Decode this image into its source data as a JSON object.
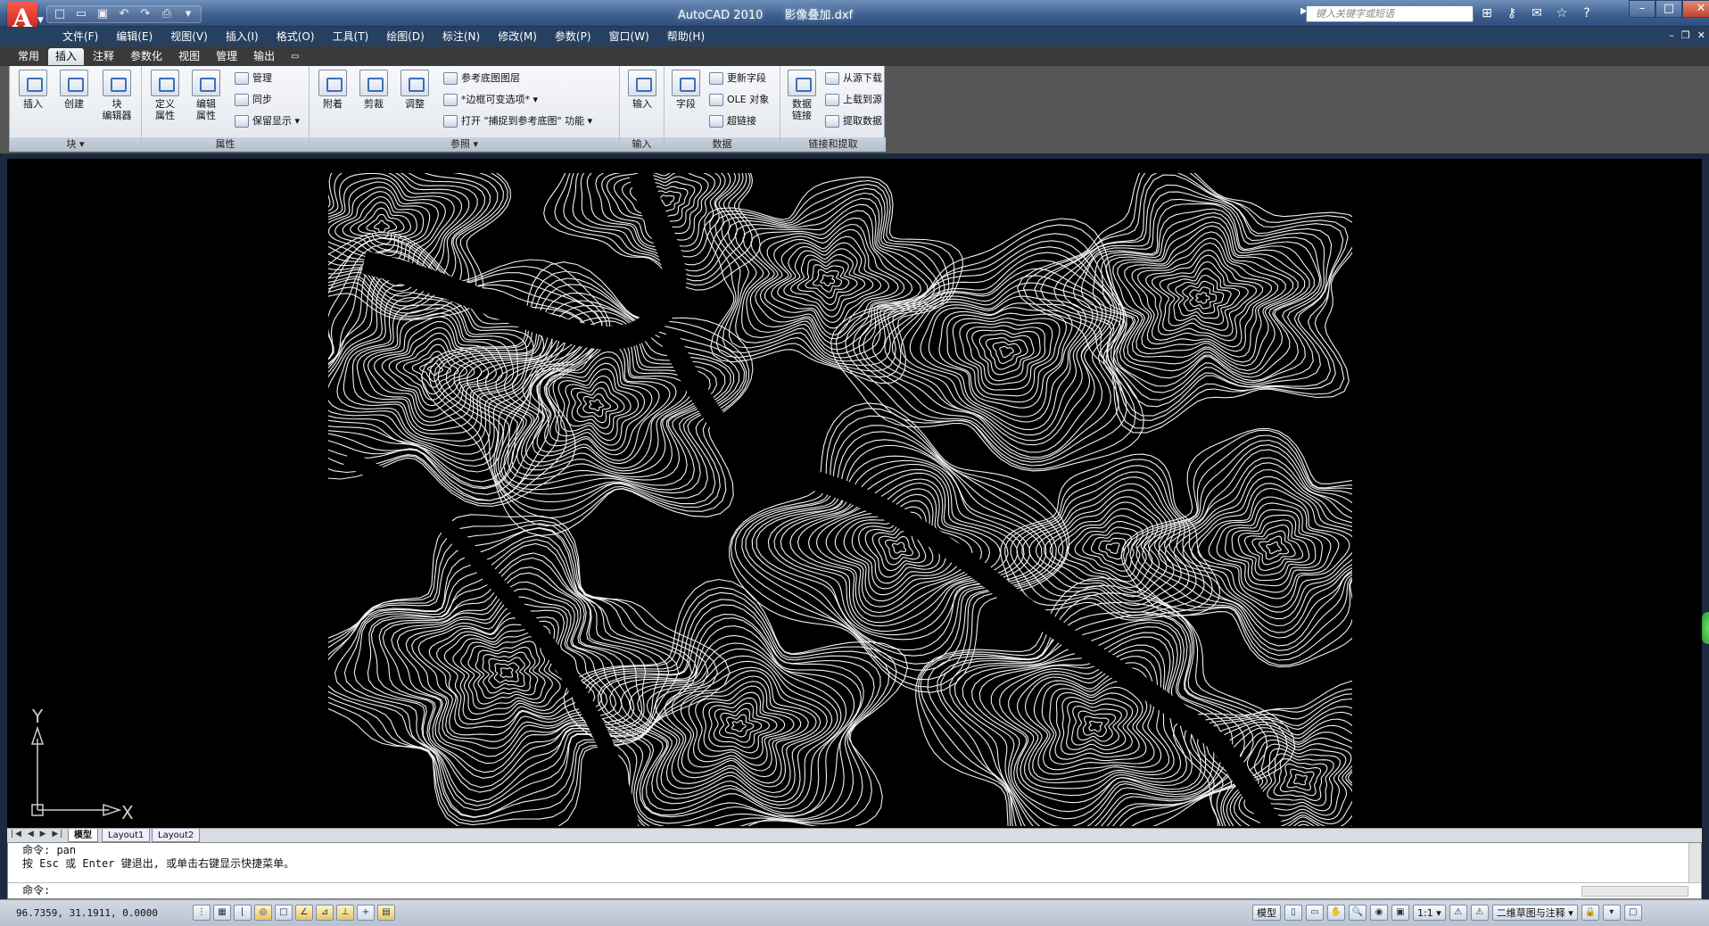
{
  "app": {
    "name": "AutoCAD 2010",
    "file": "影像叠加.dxf"
  },
  "quick_access": [
    "new-icon",
    "open-icon",
    "save-icon",
    "undo-icon",
    "redo-icon",
    "print-icon",
    "dropdown-icon"
  ],
  "search": {
    "placeholder": "键入关键字或短语"
  },
  "info_icons": [
    "binoculars-icon",
    "key-icon",
    "comm-center-icon",
    "star-icon",
    "help-icon"
  ],
  "menus": [
    "文件(F)",
    "编辑(E)",
    "视图(V)",
    "插入(I)",
    "格式(O)",
    "工具(T)",
    "绘图(D)",
    "标注(N)",
    "修改(M)",
    "参数(P)",
    "窗口(W)",
    "帮助(H)"
  ],
  "ribbon_tabs": [
    "常用",
    "插入",
    "注释",
    "参数化",
    "视图",
    "管理",
    "输出"
  ],
  "active_tab": "插入",
  "panels": {
    "block": {
      "title": "块 ▾",
      "insert": "插入",
      "create": "创建",
      "editor_1": "块",
      "editor_2": "编辑器"
    },
    "attributes": {
      "title": "属性",
      "define_1": "定义",
      "define_2": "属性",
      "edit_1": "编辑",
      "edit_2": "属性",
      "manage": "管理",
      "sync": "同步",
      "retain": "保留显示 ▾"
    },
    "reference": {
      "title": "参照 ▾",
      "attach": "附着",
      "clip": "剪裁",
      "adjust": "调整",
      "underlay_layers": "参考底图图层",
      "frames": "*边框可变选项* ▾",
      "snap": "打开 \"捕捉到参考底图\" 功能 ▾"
    },
    "import": {
      "title": "输入",
      "import": "输入"
    },
    "data": {
      "title": "数据",
      "field": "字段",
      "update_fields": "更新字段",
      "ole": "OLE 对象",
      "hyperlink": "超链接"
    },
    "linking": {
      "title": "链接和提取",
      "data_link_1": "数据",
      "data_link_2": "链接",
      "download": "从源下载",
      "upload": "上载到源",
      "extract": "提取数据"
    }
  },
  "ucs": {
    "x": "X",
    "y": "Y"
  },
  "layout_tabs": [
    "模型",
    "Layout1",
    "Layout2"
  ],
  "command": {
    "line1": "命令: pan",
    "line2": "按 Esc 或 Enter 键退出, 或单击右键显示快捷菜单。",
    "prompt": "命令:"
  },
  "status": {
    "coords": "96.7359, 31.1911, 0.0000",
    "model": "模型",
    "scale": "1:1 ▾",
    "workspace": "二维草图与注释 ▾"
  }
}
